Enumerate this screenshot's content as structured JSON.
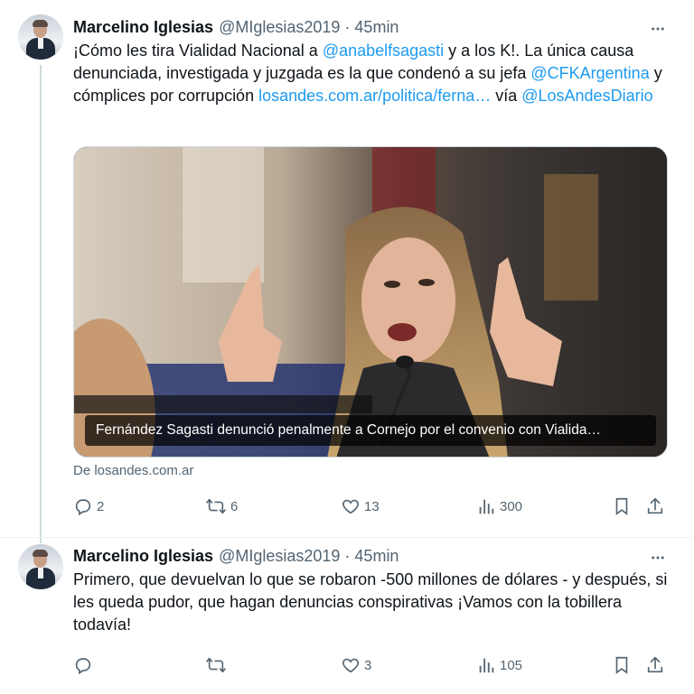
{
  "tweets": [
    {
      "author_name": "Marcelino Iglesias",
      "handle": "@MIglesias2019",
      "separator": "·",
      "time": "45min",
      "text_parts": {
        "p1": "¡Cómo les tira Vialidad Nacional a ",
        "mention1": "@anabelfsagasti",
        "p2": " y a los K!. La única causa denunciada, investigada y juzgada es la que condenó a su jefa ",
        "mention2": "@CFKArgentina",
        "p3": " y cómplices por corrupción ",
        "url": "losandes.com.ar/politica/ferna…",
        "p4": " vía ",
        "mention3": "@LosAndesDiario"
      },
      "card": {
        "caption": "Fernández Sagasti denunció penalmente a Cornejo por el convenio con Vialida…",
        "source": "De losandes.com.ar"
      },
      "stats": {
        "replies": "2",
        "retweets": "6",
        "likes": "13",
        "views": "300"
      }
    },
    {
      "author_name": "Marcelino Iglesias",
      "handle": "@MIglesias2019",
      "separator": "·",
      "time": "45min",
      "text": "Primero, que devuelvan lo que se robaron -500 millones de dólares - y después, si les queda pudor, que hagan denuncias conspirativas ¡Vamos con la tobillera todavía!",
      "stats": {
        "replies": "",
        "retweets": "",
        "likes": "3",
        "views": "105"
      }
    }
  ],
  "icons": {
    "more": "more-horizontal-icon",
    "reply": "reply-icon",
    "retweet": "retweet-icon",
    "like": "heart-icon",
    "views": "views-icon",
    "bookmark": "bookmark-icon",
    "share": "share-icon"
  },
  "colors": {
    "link": "#1d9bf0",
    "muted": "#536471",
    "text": "#0f1419"
  }
}
